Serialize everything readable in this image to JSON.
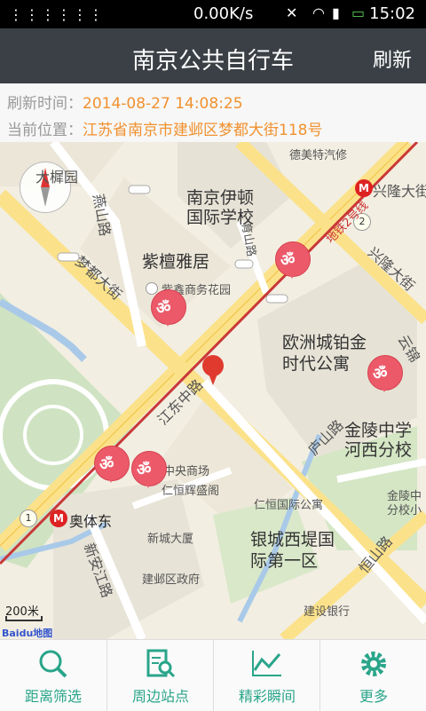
{
  "status": {
    "speed": "0.00K/s",
    "time": "15:02"
  },
  "header": {
    "title": "南京公共自行车",
    "refresh_label": "刷新"
  },
  "info": {
    "refresh_label": "刷新时间：",
    "refresh_value": "2014-08-27 14:08:25",
    "location_label": "当前位置：",
    "location_value": "江苏省南京市建邺区梦都大街118号"
  },
  "map": {
    "labels": {
      "dameiyuan": "大樨园",
      "demeite": "德美特汽修",
      "xinglongdajie_top": "兴隆大街",
      "yiton_school": "南京伊顿\n国际学校",
      "yanshanlu": "燕山路",
      "zitanyaju": "紫檀雅居",
      "zixin": "紫鑫商务花园",
      "mengdudajie": "梦都大街",
      "yushanlu": "育山路",
      "metro_line2": "地铁2号线",
      "xinglongdajie_right": "兴隆大街",
      "ouzhoucheng": "欧洲城铂金\n时代公寓",
      "yunjin": "云锦",
      "jiangdongzhonglu": "江东中路",
      "lushanlu": "庐山路",
      "jinling_school": "金陵中学\n河西分校",
      "jinling_small": "金陵中\n分校小",
      "zhongyang": "中央商场",
      "renhenghui": "仁恒辉盛阁",
      "renhengguoji": "仁恒国际公寓",
      "aotidong": "奥体东",
      "xinchengdasha": "新城大厦",
      "xinanjianglu": "新安江路",
      "yinchengxidi": "银城西堤国\n际第一区",
      "hengshanlu": "恒山路",
      "jianyequ": "建邺区政府",
      "jianshebank": "建设银行",
      "lushanlu_top": "路"
    },
    "metro_lines": {
      "line1": "1",
      "line2": "2"
    },
    "scale": "200米",
    "brand": "Baidu地图"
  },
  "tabs": [
    {
      "label": "距离筛选",
      "icon": "search-icon"
    },
    {
      "label": "周边站点",
      "icon": "nearby-station-icon"
    },
    {
      "label": "精彩瞬间",
      "icon": "chart-icon"
    },
    {
      "label": "更多",
      "icon": "gear-icon"
    }
  ],
  "colors": {
    "accent": "#2aa58a",
    "title_bg": "#3b4046",
    "info_value": "#f0912f",
    "bike_pin": "#ec5a6a",
    "location_pin": "#e03a2f"
  }
}
